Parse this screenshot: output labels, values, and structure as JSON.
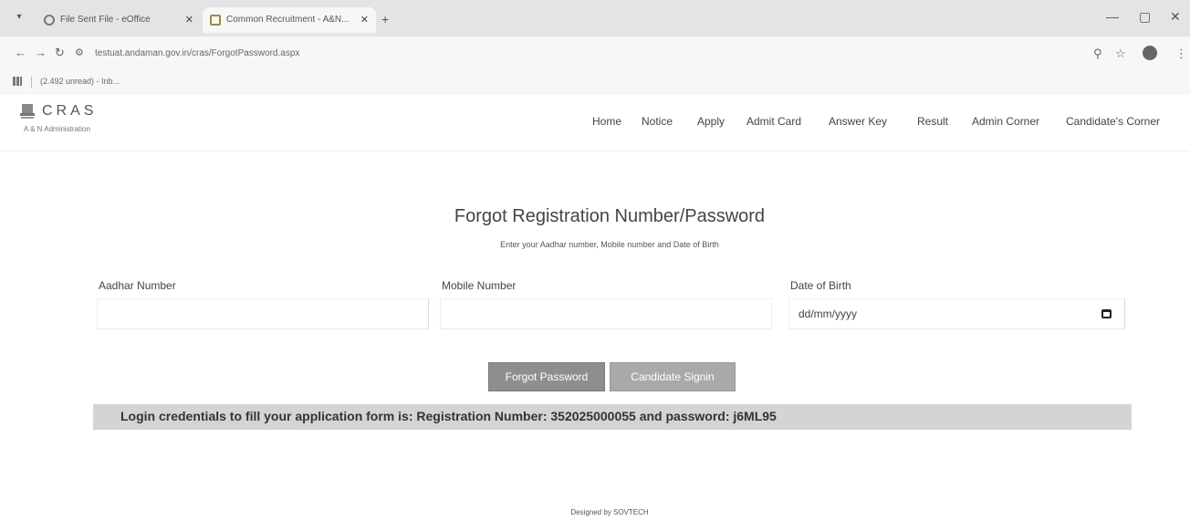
{
  "browser": {
    "tabs": [
      {
        "label": "File Sent File - eOffice"
      },
      {
        "label": "Common Recruitment - A&N..."
      }
    ],
    "url": "testuat.andaman.gov.in/cras/ForgotPassword.aspx",
    "bookmark": "(2.492 unread) - Inb..."
  },
  "site": {
    "logo_title": "CRAS",
    "logo_subtitle": "A & N Administration",
    "nav": [
      "Home",
      "Notice",
      "Apply",
      "Admit Card",
      "Answer Key",
      "Result",
      "Admin Corner",
      "Candidate's Corner"
    ]
  },
  "form": {
    "title": "Forgot Registration Number/Password",
    "subtitle": "Enter your Aadhar number, Mobile number and Date of Birth",
    "aadhar_label": "Aadhar Number",
    "aadhar_value": "",
    "mobile_label": "Mobile Number",
    "mobile_value": "",
    "dob_label": "Date of Birth",
    "dob_placeholder": "dd/mm/yyyy",
    "forgot_button": "Forgot Password",
    "signin_button": "Candidate Signin",
    "credentials_message": "Login credentials to fill your application form is: Registration Number: 352025000055 and password: j6ML95"
  },
  "footer": "Designed by SOVTECH",
  "colors": {
    "button_primary": "#8e8e8e",
    "button_secondary": "#a9a9a9",
    "banner": "#d4d4d4"
  }
}
